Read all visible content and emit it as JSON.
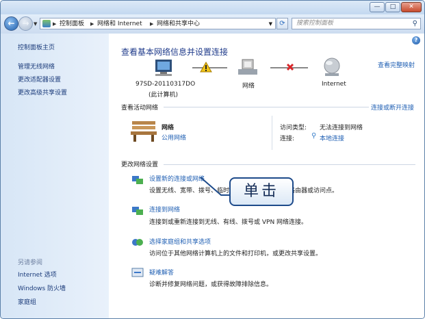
{
  "titlebar": {
    "minimize": "—",
    "maximize": "□",
    "close": "✕"
  },
  "address": {
    "crumbs": [
      "控制面板",
      "网络和 Internet",
      "网络和共享中心"
    ],
    "search_placeholder": "搜索控制面板"
  },
  "sidebar": {
    "items": [
      "控制面板主页",
      "管理无线网络",
      "更改适配器设置",
      "更改高级共享设置"
    ],
    "see_also_title": "另请参阅",
    "see_also": [
      "Internet 选项",
      "Windows 防火墙",
      "家庭组"
    ]
  },
  "main": {
    "heading": "查看基本网络信息并设置连接",
    "full_map": "查看完整映射",
    "nodes": {
      "computer": "97SD-20110317DO",
      "computer_sub": "(此计算机)",
      "network": "网络",
      "internet": "Internet"
    },
    "active_title": "查看活动网络",
    "connect_disconnect": "连接或断开连接",
    "network_name": "网络",
    "network_type": "公用网络",
    "access_label": "访问类型:",
    "access_value": "无法连接到网络",
    "conn_label": "连接:",
    "conn_value": "本地连接",
    "change_title": "更改网络设置",
    "tasks": [
      {
        "title": "设置新的连接或网络",
        "desc": "设置无线、宽带、拨号、临时或 VPN 连接；或设置路由器或访问点。"
      },
      {
        "title": "连接到网络",
        "desc": "连接到或重新连接到无线、有线、拨号或 VPN 网络连接。"
      },
      {
        "title": "选择家庭组和共享选项",
        "desc": "访问位于其他网络计算机上的文件和打印机，或更改共享设置。"
      },
      {
        "title": "疑难解答",
        "desc": "诊断并修复网络问题，或获得故障排除信息。"
      }
    ]
  },
  "callout": "单击"
}
